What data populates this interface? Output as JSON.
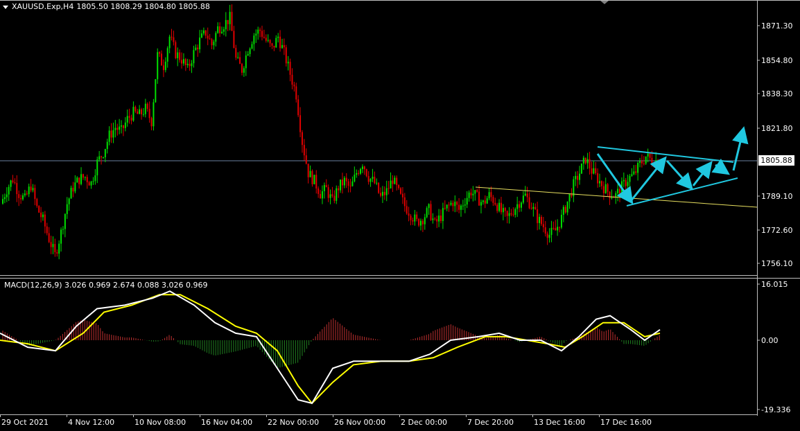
{
  "header": {
    "symbol": "XAUUSD.Exp,H4",
    "open": "1805.50",
    "high": "1808.29",
    "low": "1804.80",
    "close": "1805.88"
  },
  "current_price_label": "1805.88",
  "price_axis_labels": [
    "1871.30",
    "1854.80",
    "1838.30",
    "1821.80",
    "1789.10",
    "1772.60",
    "1756.10"
  ],
  "macd": {
    "label": "MACD(12,26,9) 3.026 0.969 2.674 0.088 3.026 0.969",
    "axis_labels": [
      "16.015",
      "0.00",
      "-19.336"
    ]
  },
  "time_axis_labels": [
    "29 Oct 2021",
    "4 Nov 12:00",
    "10 Nov 08:00",
    "16 Nov 04:00",
    "22 Nov 00:00",
    "26 Nov 00:00",
    "2 Dec 00:00",
    "7 Dec 20:00",
    "13 Dec 16:00",
    "17 Dec 16:00"
  ],
  "colors": {
    "background": "#000000",
    "bull": "#00e000",
    "bear": "#e00000",
    "grid_line": "#6a7fa0",
    "trend_yellow": "#e8e060",
    "arrows": "#20c8e0",
    "macd_main": "#ffffff",
    "macd_signal": "#ffff00",
    "hist_pos": "#c03030",
    "hist_neg": "#208020"
  },
  "price_path": [
    [
      1785,
      0
    ],
    [
      1792,
      0
    ],
    [
      1797,
      0
    ],
    [
      1790,
      0
    ],
    [
      1787,
      0
    ],
    [
      1794,
      0
    ],
    [
      1783,
      0
    ],
    [
      1777,
      0
    ],
    [
      1768,
      0
    ],
    [
      1760,
      0
    ],
    [
      1771,
      0
    ],
    [
      1785,
      0
    ],
    [
      1793,
      0
    ],
    [
      1797,
      0
    ],
    [
      1798,
      0
    ],
    [
      1795,
      0
    ],
    [
      1805,
      0
    ],
    [
      1810,
      0
    ],
    [
      1818,
      0
    ],
    [
      1822,
      0
    ],
    [
      1820,
      0
    ],
    [
      1826,
      0
    ],
    [
      1829,
      0
    ],
    [
      1828,
      0
    ],
    [
      1831,
      0
    ],
    [
      1825,
      0
    ],
    [
      1857,
      0
    ],
    [
      1852,
      0
    ],
    [
      1866,
      0
    ],
    [
      1858,
      0
    ],
    [
      1855,
      0
    ],
    [
      1850,
      0
    ],
    [
      1858,
      0
    ],
    [
      1864,
      0
    ],
    [
      1868,
      0
    ],
    [
      1862,
      0
    ],
    [
      1870,
      0
    ],
    [
      1872,
      0
    ],
    [
      1875,
      0
    ],
    [
      1855,
      0
    ],
    [
      1850,
      0
    ],
    [
      1860,
      0
    ],
    [
      1867,
      0
    ],
    [
      1869,
      0
    ],
    [
      1864,
      0
    ],
    [
      1860,
      0
    ],
    [
      1866,
      0
    ],
    [
      1858,
      0
    ],
    [
      1848,
      0
    ],
    [
      1838,
      0
    ],
    [
      1815,
      0
    ],
    [
      1800,
      0
    ],
    [
      1796,
      0
    ],
    [
      1790,
      0
    ],
    [
      1792,
      0
    ],
    [
      1786,
      0
    ],
    [
      1793,
      0
    ],
    [
      1796,
      0
    ],
    [
      1792,
      0
    ],
    [
      1800,
      0
    ],
    [
      1805,
      0
    ],
    [
      1798,
      0
    ],
    [
      1795,
      0
    ],
    [
      1788,
      0
    ],
    [
      1791,
      0
    ],
    [
      1797,
      0
    ],
    [
      1790,
      0
    ],
    [
      1784,
      0
    ],
    [
      1780,
      0
    ],
    [
      1776,
      0
    ],
    [
      1778,
      0
    ],
    [
      1782,
      0
    ],
    [
      1775,
      0
    ],
    [
      1779,
      0
    ],
    [
      1783,
      0
    ],
    [
      1786,
      0
    ],
    [
      1782,
      0
    ],
    [
      1787,
      0
    ],
    [
      1791,
      0
    ],
    [
      1788,
      0
    ],
    [
      1785,
      0
    ],
    [
      1789,
      0
    ],
    [
      1786,
      0
    ],
    [
      1781,
      0
    ],
    [
      1778,
      0
    ],
    [
      1782,
      0
    ],
    [
      1786,
      0
    ],
    [
      1789,
      0
    ],
    [
      1784,
      0
    ],
    [
      1778,
      0
    ],
    [
      1774,
      0
    ],
    [
      1770,
      0
    ],
    [
      1772,
      0
    ],
    [
      1778,
      0
    ],
    [
      1786,
      0
    ],
    [
      1794,
      0
    ],
    [
      1800,
      0
    ],
    [
      1807,
      0
    ],
    [
      1801,
      0
    ],
    [
      1797,
      0
    ],
    [
      1793,
      0
    ],
    [
      1790,
      0
    ],
    [
      1789,
      0
    ],
    [
      1793,
      0
    ],
    [
      1797,
      0
    ],
    [
      1799,
      0
    ],
    [
      1804,
      0
    ],
    [
      1808,
      0
    ],
    [
      1806,
      0
    ],
    [
      1806,
      0
    ]
  ]
}
